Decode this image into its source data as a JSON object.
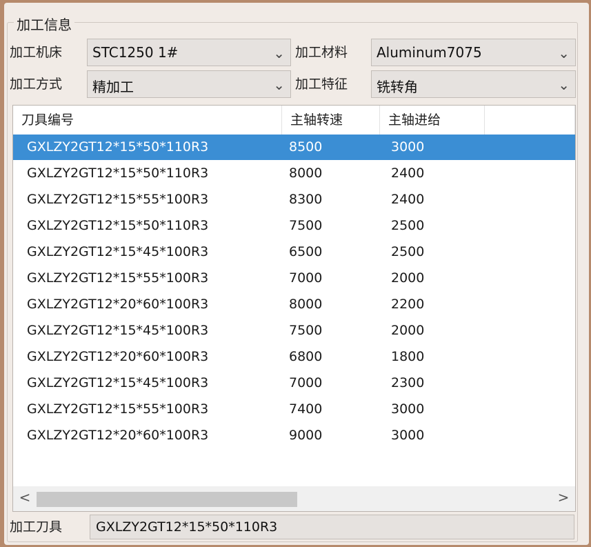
{
  "group_title": "加工信息",
  "fields": {
    "machine": {
      "label": "加工机床",
      "value": "STC1250 1#"
    },
    "material": {
      "label": "加工材料",
      "value": "Aluminum7075"
    },
    "method": {
      "label": "加工方式",
      "value": "精加工"
    },
    "feature": {
      "label": "加工特征",
      "value": "铣转角"
    }
  },
  "table": {
    "columns": [
      "刀具编号",
      "主轴转速",
      "主轴进给"
    ],
    "selected_index": 0,
    "rows": [
      [
        "GXLZY2GT12*15*50*110R3",
        "8500",
        "3000"
      ],
      [
        "GXLZY2GT12*15*50*110R3",
        "8000",
        "2400"
      ],
      [
        "GXLZY2GT12*15*55*100R3",
        "8300",
        "2400"
      ],
      [
        "GXLZY2GT12*15*50*110R3",
        "7500",
        "2500"
      ],
      [
        "GXLZY2GT12*15*45*100R3",
        "6500",
        "2500"
      ],
      [
        "GXLZY2GT12*15*55*100R3",
        "7000",
        "2000"
      ],
      [
        "GXLZY2GT12*20*60*100R3",
        "8000",
        "2200"
      ],
      [
        "GXLZY2GT12*15*45*100R3",
        "7500",
        "2000"
      ],
      [
        "GXLZY2GT12*20*60*100R3",
        "6800",
        "1800"
      ],
      [
        "GXLZY2GT12*15*45*100R3",
        "7000",
        "2300"
      ],
      [
        "GXLZY2GT12*15*55*100R3",
        "7400",
        "3000"
      ],
      [
        "GXLZY2GT12*20*60*100R3",
        "9000",
        "3000"
      ]
    ]
  },
  "scrollbar": {
    "left_arrow": "<",
    "right_arrow": ">"
  },
  "tool": {
    "label": "加工刀具",
    "value": "GXLZY2GT12*15*50*110R3"
  },
  "icons": {
    "dropdown": "chevron-down-icon"
  },
  "colors": {
    "selection": "#3b8ed4",
    "frame": "#b68a6c"
  }
}
